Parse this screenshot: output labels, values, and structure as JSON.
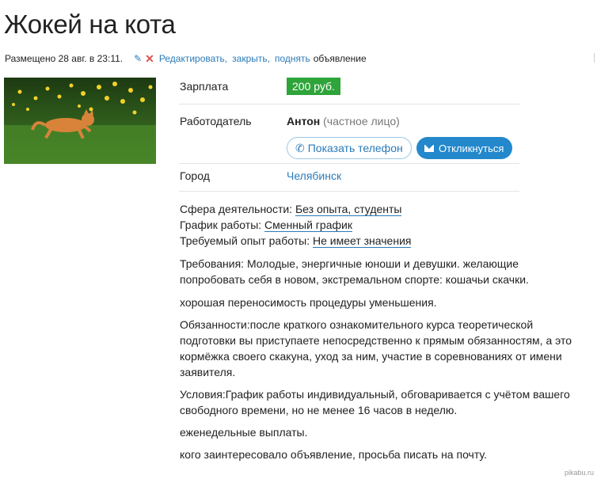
{
  "title": "Жокей на кота",
  "meta": {
    "posted": "Размещено 28 авг. в 23:11.",
    "edit": "Редактировать,",
    "close": "закрыть,",
    "raise": "поднять",
    "suffix": "объявление"
  },
  "fields": {
    "salary_label": "Зарплата",
    "salary_value": "200 руб.",
    "employer_label": "Работодатель",
    "employer_name": "Антон",
    "employer_type": "(частное лицо)",
    "show_phone": "Показать телефон",
    "respond": "Откликнуться",
    "city_label": "Город",
    "city_value": "Челябинск"
  },
  "details": {
    "sphere_label": "Сфера деятельности:",
    "sphere_value": "Без опыта, студенты",
    "schedule_label": "График работы:",
    "schedule_value": "Сменный график",
    "experience_label": "Требуемый опыт работы:",
    "experience_value": "Не имеет значения"
  },
  "text": {
    "requirements": "Требования: Молодые, энергичные юноши и девушки. желающие попробовать себя в новом, экстремальном спорте: кошачьи скачки.",
    "tolerance": "хорошая переносимость процедуры уменьшения.",
    "duties": "Обязанности:после краткого ознакомительного курса теоретической подготовки вы приступаете непосредственно к прямым обязанностям, а это кормёжка своего скакуна, уход за ним, участие в соревнованиях от имени заявителя.",
    "conditions": "Условия:График работы индивидуальный, обговаривается с учётом вашего свободного времени, но не менее 16 часов в неделю.",
    "payments": "еженедельные выплаты.",
    "contact": "кого заинтересовало объявление, просьба писать на почту."
  },
  "watermark": "pikabu.ru",
  "icons": {
    "edit": "pencil-icon",
    "delete": "cross-icon",
    "phone": "phone-icon",
    "mail": "envelope-icon"
  },
  "colors": {
    "accent": "#2b7bb9",
    "salary_bg": "#2ea43a",
    "button_bg": "#2388cc",
    "delete": "#d9534f"
  }
}
